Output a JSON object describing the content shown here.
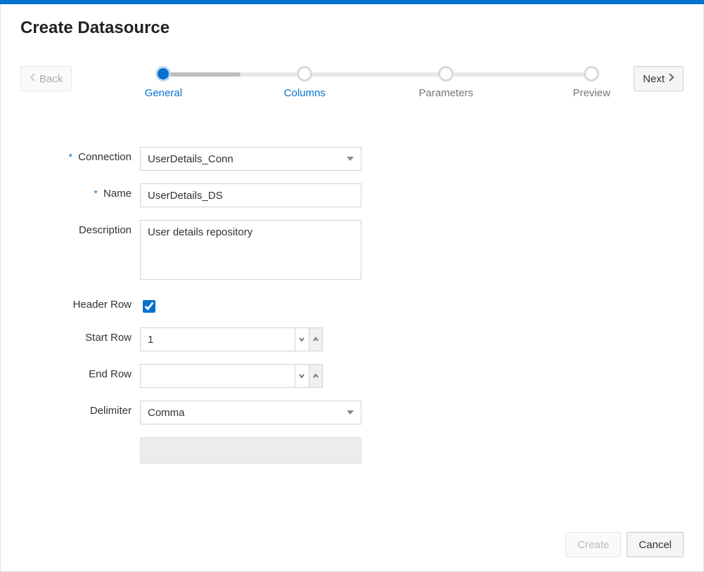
{
  "header": {
    "title": "Create Datasource",
    "back_label": "Back",
    "next_label": "Next"
  },
  "steps": [
    {
      "label": "General",
      "state": "active"
    },
    {
      "label": "Columns",
      "state": "linkish"
    },
    {
      "label": "Parameters",
      "state": ""
    },
    {
      "label": "Preview",
      "state": ""
    }
  ],
  "form": {
    "connection": {
      "label": "Connection",
      "value": "UserDetails_Conn",
      "required": true
    },
    "name": {
      "label": "Name",
      "value": "UserDetails_DS",
      "required": true
    },
    "description": {
      "label": "Description",
      "value": "User details repository"
    },
    "header_row": {
      "label": "Header Row",
      "checked": true
    },
    "start_row": {
      "label": "Start Row",
      "value": "1"
    },
    "end_row": {
      "label": "End Row",
      "value": ""
    },
    "delimiter": {
      "label": "Delimiter",
      "value": "Comma"
    }
  },
  "footer": {
    "create_label": "Create",
    "cancel_label": "Cancel"
  }
}
